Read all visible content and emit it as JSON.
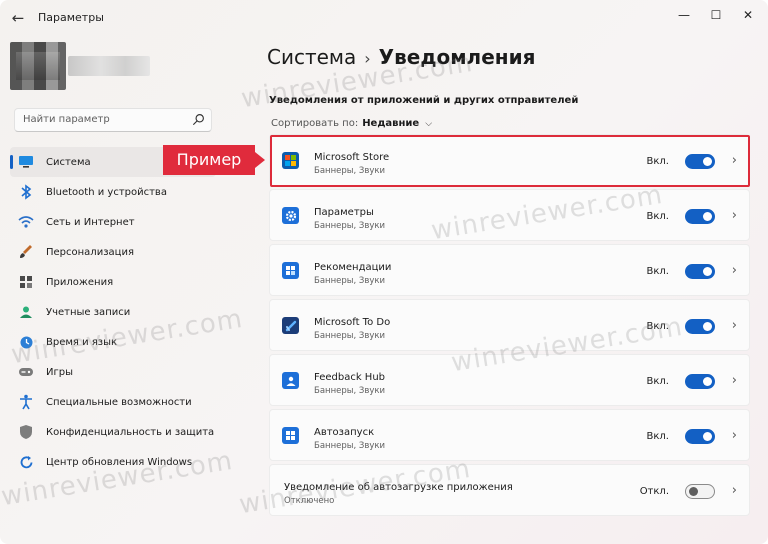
{
  "titlebar": {
    "back_glyph": "←",
    "title": "Параметры",
    "minimize_glyph": "—",
    "maximize_glyph": "☐",
    "close_glyph": "✕"
  },
  "search": {
    "placeholder": "Найти параметр"
  },
  "sidebar": {
    "items": [
      {
        "label": "Система",
        "icon": "monitor-icon",
        "active": true
      },
      {
        "label": "Bluetooth и устройства",
        "icon": "bluetooth-icon"
      },
      {
        "label": "Сеть и Интернет",
        "icon": "wifi-icon"
      },
      {
        "label": "Персонализация",
        "icon": "brush-icon"
      },
      {
        "label": "Приложения",
        "icon": "apps-icon"
      },
      {
        "label": "Учетные записи",
        "icon": "person-icon"
      },
      {
        "label": "Время и язык",
        "icon": "globe-clock-icon"
      },
      {
        "label": "Игры",
        "icon": "gamepad-icon"
      },
      {
        "label": "Специальные возможности",
        "icon": "accessibility-icon"
      },
      {
        "label": "Конфиденциальность и защита",
        "icon": "shield-icon"
      },
      {
        "label": "Центр обновления Windows",
        "icon": "update-icon"
      }
    ]
  },
  "main": {
    "breadcrumb_parent": "Система",
    "breadcrumb_sep": "›",
    "breadcrumb_current": "Уведомления",
    "section_title": "Уведомления от приложений и других отправителей",
    "sort_label": "Сортировать по:",
    "sort_value": "Недавние",
    "apps": [
      {
        "name": "Microsoft Store",
        "sub": "Баннеры, Звуки",
        "state": "Вкл.",
        "on": true,
        "icon": "store-icon"
      },
      {
        "name": "Параметры",
        "sub": "Баннеры, Звуки",
        "state": "Вкл.",
        "on": true,
        "icon": "settings-gear-icon"
      },
      {
        "name": "Рекомендации",
        "sub": "Баннеры, Звуки",
        "state": "Вкл.",
        "on": true,
        "icon": "tips-icon"
      },
      {
        "name": "Microsoft To Do",
        "sub": "Баннеры, Звуки",
        "state": "Вкл.",
        "on": true,
        "icon": "todo-check-icon"
      },
      {
        "name": "Feedback Hub",
        "sub": "Баннеры, Звуки",
        "state": "Вкл.",
        "on": true,
        "icon": "feedback-icon"
      },
      {
        "name": "Автозапуск",
        "sub": "Баннеры, Звуки",
        "state": "Вкл.",
        "on": true,
        "icon": "autoplay-icon"
      },
      {
        "name": "Уведомление об автозагрузке приложения",
        "sub": "Отключено",
        "state": "Откл.",
        "on": false,
        "icon": "startup-icon"
      }
    ]
  },
  "callout": {
    "text": "Пример"
  },
  "watermark": {
    "text": "winreviewer.com"
  },
  "colors": {
    "accent": "#1360c4",
    "callout": "#e02b3c"
  }
}
